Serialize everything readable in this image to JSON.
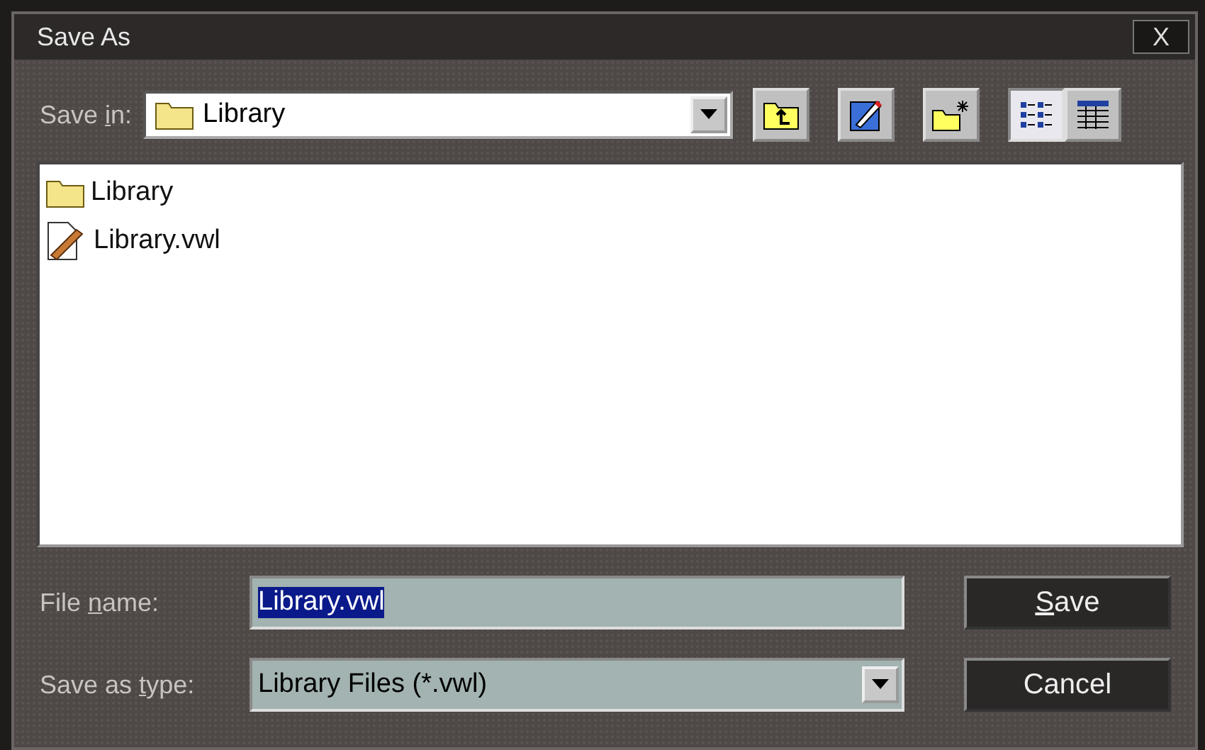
{
  "window": {
    "title": "Save As",
    "close": "X"
  },
  "save_in": {
    "label_parts": [
      "Save ",
      "i",
      "n:"
    ],
    "value": "Library"
  },
  "toolbar": [
    {
      "kind": "up",
      "selected": false
    },
    {
      "kind": "edit",
      "selected": false
    },
    {
      "kind": "new",
      "selected": false
    },
    {
      "kind": "list",
      "selected": true
    },
    {
      "kind": "details",
      "selected": false
    }
  ],
  "files": [
    {
      "kind": "folder",
      "name": "Library"
    },
    {
      "kind": "document",
      "name": "Library.vwl"
    }
  ],
  "file_name": {
    "label_parts": [
      "File ",
      "n",
      "ame:"
    ],
    "value": "Library.vwl"
  },
  "save_as_type": {
    "label_parts": [
      "Save as ",
      "t",
      "ype:"
    ],
    "value": "Library Files (*.vwl)"
  },
  "buttons": [
    {
      "segments": [
        {
          "text": "S",
          "underlined": true
        },
        {
          "text": "ave",
          "underlined": false
        }
      ]
    },
    {
      "segments": [
        {
          "text": "Cancel",
          "underlined": false
        }
      ]
    }
  ]
}
